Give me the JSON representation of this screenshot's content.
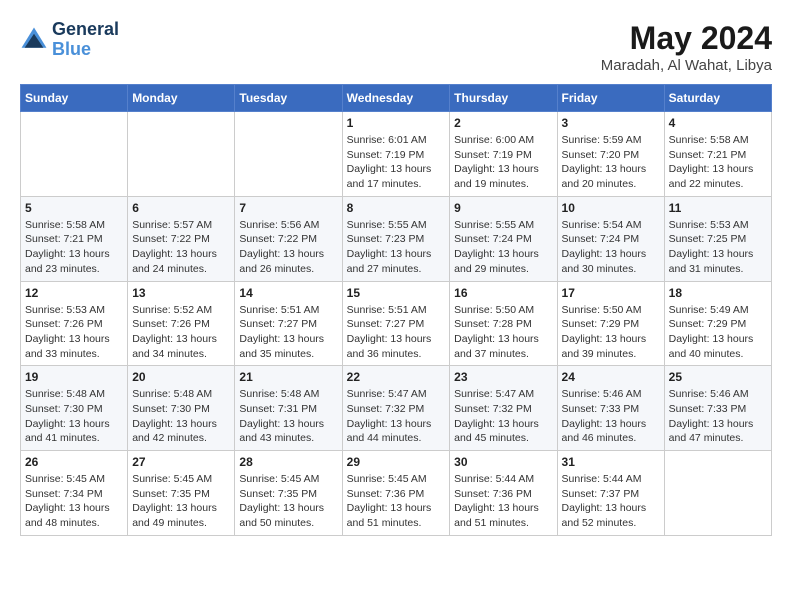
{
  "header": {
    "logo_line1": "General",
    "logo_line2": "Blue",
    "month": "May 2024",
    "location": "Maradah, Al Wahat, Libya"
  },
  "weekdays": [
    "Sunday",
    "Monday",
    "Tuesday",
    "Wednesday",
    "Thursday",
    "Friday",
    "Saturday"
  ],
  "weeks": [
    [
      {
        "day": "",
        "info": ""
      },
      {
        "day": "",
        "info": ""
      },
      {
        "day": "",
        "info": ""
      },
      {
        "day": "1",
        "info": "Sunrise: 6:01 AM\nSunset: 7:19 PM\nDaylight: 13 hours\nand 17 minutes."
      },
      {
        "day": "2",
        "info": "Sunrise: 6:00 AM\nSunset: 7:19 PM\nDaylight: 13 hours\nand 19 minutes."
      },
      {
        "day": "3",
        "info": "Sunrise: 5:59 AM\nSunset: 7:20 PM\nDaylight: 13 hours\nand 20 minutes."
      },
      {
        "day": "4",
        "info": "Sunrise: 5:58 AM\nSunset: 7:21 PM\nDaylight: 13 hours\nand 22 minutes."
      }
    ],
    [
      {
        "day": "5",
        "info": "Sunrise: 5:58 AM\nSunset: 7:21 PM\nDaylight: 13 hours\nand 23 minutes."
      },
      {
        "day": "6",
        "info": "Sunrise: 5:57 AM\nSunset: 7:22 PM\nDaylight: 13 hours\nand 24 minutes."
      },
      {
        "day": "7",
        "info": "Sunrise: 5:56 AM\nSunset: 7:22 PM\nDaylight: 13 hours\nand 26 minutes."
      },
      {
        "day": "8",
        "info": "Sunrise: 5:55 AM\nSunset: 7:23 PM\nDaylight: 13 hours\nand 27 minutes."
      },
      {
        "day": "9",
        "info": "Sunrise: 5:55 AM\nSunset: 7:24 PM\nDaylight: 13 hours\nand 29 minutes."
      },
      {
        "day": "10",
        "info": "Sunrise: 5:54 AM\nSunset: 7:24 PM\nDaylight: 13 hours\nand 30 minutes."
      },
      {
        "day": "11",
        "info": "Sunrise: 5:53 AM\nSunset: 7:25 PM\nDaylight: 13 hours\nand 31 minutes."
      }
    ],
    [
      {
        "day": "12",
        "info": "Sunrise: 5:53 AM\nSunset: 7:26 PM\nDaylight: 13 hours\nand 33 minutes."
      },
      {
        "day": "13",
        "info": "Sunrise: 5:52 AM\nSunset: 7:26 PM\nDaylight: 13 hours\nand 34 minutes."
      },
      {
        "day": "14",
        "info": "Sunrise: 5:51 AM\nSunset: 7:27 PM\nDaylight: 13 hours\nand 35 minutes."
      },
      {
        "day": "15",
        "info": "Sunrise: 5:51 AM\nSunset: 7:27 PM\nDaylight: 13 hours\nand 36 minutes."
      },
      {
        "day": "16",
        "info": "Sunrise: 5:50 AM\nSunset: 7:28 PM\nDaylight: 13 hours\nand 37 minutes."
      },
      {
        "day": "17",
        "info": "Sunrise: 5:50 AM\nSunset: 7:29 PM\nDaylight: 13 hours\nand 39 minutes."
      },
      {
        "day": "18",
        "info": "Sunrise: 5:49 AM\nSunset: 7:29 PM\nDaylight: 13 hours\nand 40 minutes."
      }
    ],
    [
      {
        "day": "19",
        "info": "Sunrise: 5:48 AM\nSunset: 7:30 PM\nDaylight: 13 hours\nand 41 minutes."
      },
      {
        "day": "20",
        "info": "Sunrise: 5:48 AM\nSunset: 7:30 PM\nDaylight: 13 hours\nand 42 minutes."
      },
      {
        "day": "21",
        "info": "Sunrise: 5:48 AM\nSunset: 7:31 PM\nDaylight: 13 hours\nand 43 minutes."
      },
      {
        "day": "22",
        "info": "Sunrise: 5:47 AM\nSunset: 7:32 PM\nDaylight: 13 hours\nand 44 minutes."
      },
      {
        "day": "23",
        "info": "Sunrise: 5:47 AM\nSunset: 7:32 PM\nDaylight: 13 hours\nand 45 minutes."
      },
      {
        "day": "24",
        "info": "Sunrise: 5:46 AM\nSunset: 7:33 PM\nDaylight: 13 hours\nand 46 minutes."
      },
      {
        "day": "25",
        "info": "Sunrise: 5:46 AM\nSunset: 7:33 PM\nDaylight: 13 hours\nand 47 minutes."
      }
    ],
    [
      {
        "day": "26",
        "info": "Sunrise: 5:45 AM\nSunset: 7:34 PM\nDaylight: 13 hours\nand 48 minutes."
      },
      {
        "day": "27",
        "info": "Sunrise: 5:45 AM\nSunset: 7:35 PM\nDaylight: 13 hours\nand 49 minutes."
      },
      {
        "day": "28",
        "info": "Sunrise: 5:45 AM\nSunset: 7:35 PM\nDaylight: 13 hours\nand 50 minutes."
      },
      {
        "day": "29",
        "info": "Sunrise: 5:45 AM\nSunset: 7:36 PM\nDaylight: 13 hours\nand 51 minutes."
      },
      {
        "day": "30",
        "info": "Sunrise: 5:44 AM\nSunset: 7:36 PM\nDaylight: 13 hours\nand 51 minutes."
      },
      {
        "day": "31",
        "info": "Sunrise: 5:44 AM\nSunset: 7:37 PM\nDaylight: 13 hours\nand 52 minutes."
      },
      {
        "day": "",
        "info": ""
      }
    ]
  ]
}
